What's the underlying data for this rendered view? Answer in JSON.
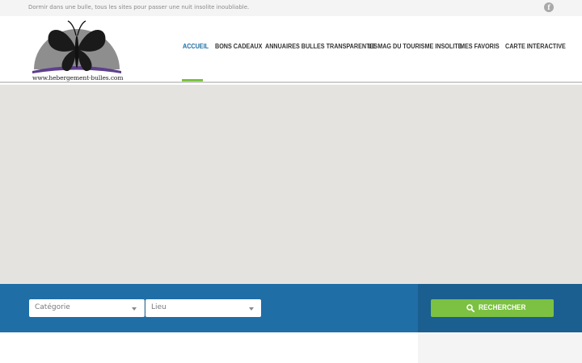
{
  "topbar": {
    "tagline": "Dormir dans une bulle, tous les sites pour passer une nuit insolite inoubliable.",
    "facebook_icon": "facebook-icon",
    "facebook_glyph": "f"
  },
  "logo": {
    "text": "www.hebergement-bulles.com",
    "icon": "butterfly-logo-icon"
  },
  "nav": {
    "items": [
      {
        "label": "ACCUEIL",
        "active": true
      },
      {
        "label": "BONS CADEAUX"
      },
      {
        "label": "ANNUAIRES BULLES TRANSPARENTES"
      },
      {
        "label": "LE MAG DU TOURISME INSOLITE"
      },
      {
        "label": "MES FAVORIS"
      },
      {
        "label": "CARTE INTÉRACTIVE"
      }
    ],
    "active_color": "#1b6ea3",
    "underline_color": "#7cc142"
  },
  "search": {
    "category_placeholder": "Catégorie",
    "location_placeholder": "Lieu",
    "button_label": "RECHERCHER",
    "button_icon": "search-icon",
    "band_color": "#1f6ea6",
    "button_color": "#7cc142"
  }
}
